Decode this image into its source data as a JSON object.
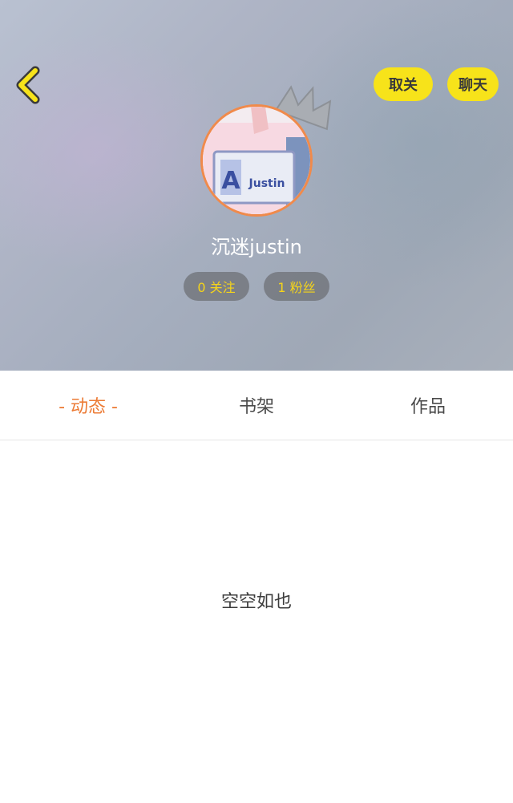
{
  "header": {
    "unfollow_label": "取关",
    "chat_label": "聊天",
    "username": "沉迷justin",
    "follow_stat": "0 关注",
    "fans_stat": "1 粉丝"
  },
  "avatar": {
    "shirt_text_main": "A",
    "shirt_text_side": "Justin"
  },
  "tabs": {
    "dynamic": "- 动态 -",
    "bookshelf": "书架",
    "works": "作品"
  },
  "content": {
    "empty_text": "空空如也"
  },
  "colors": {
    "accent_yellow": "#f7e31a",
    "tab_active": "#ec7b35",
    "avatar_border": "#f08a4b"
  }
}
